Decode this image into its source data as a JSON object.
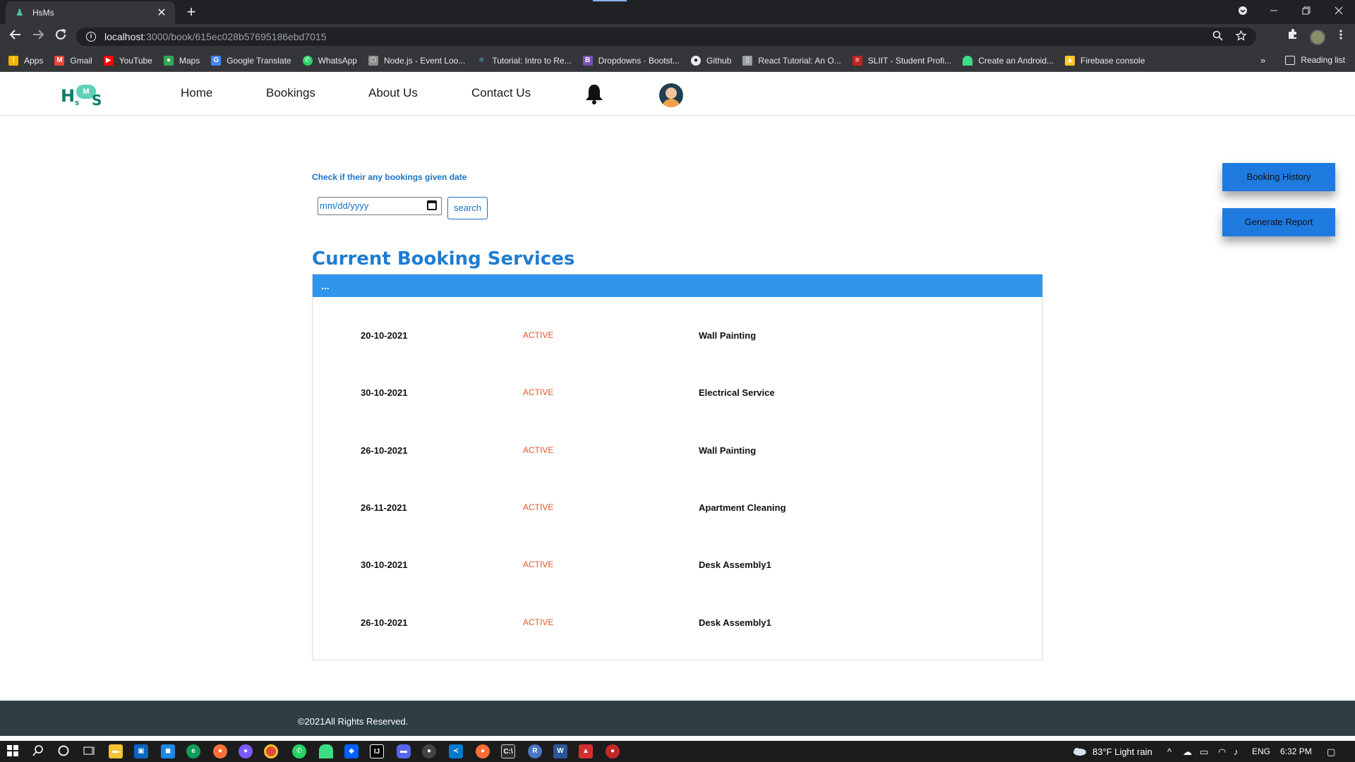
{
  "browser": {
    "tab_title": "HsMs",
    "tab_close": "✕",
    "new_tab": "+",
    "url_host": "localhost",
    "url_path": ":3000/book/615ec028b57695186ebd7015",
    "bookmarks": [
      {
        "label": "Apps",
        "icon": "apps-grid-icon",
        "color": "#f4b400"
      },
      {
        "label": "Gmail",
        "icon": "gmail-icon",
        "color": "#ea4335"
      },
      {
        "label": "YouTube",
        "icon": "youtube-icon",
        "color": "#ff0000"
      },
      {
        "label": "Maps",
        "icon": "maps-icon",
        "color": "#34a853"
      },
      {
        "label": "Google Translate",
        "icon": "translate-icon",
        "color": "#4285f4"
      },
      {
        "label": "WhatsApp",
        "icon": "whatsapp-icon",
        "color": "#25d366"
      },
      {
        "label": "Node.js - Event Loo...",
        "icon": "nodejs-icon",
        "color": "#8c8c8c"
      },
      {
        "label": "Tutorial: Intro to Re...",
        "icon": "react-icon",
        "color": "#61dafb"
      },
      {
        "label": "Dropdowns · Bootst...",
        "icon": "bootstrap-icon",
        "color": "#7952b3"
      },
      {
        "label": "Github",
        "icon": "github-icon",
        "color": "#e8eaed"
      },
      {
        "label": "React Tutorial: An O...",
        "icon": "bookmark-page-icon",
        "color": "#9aa0a6"
      },
      {
        "label": "SLIIT - Student Profi...",
        "icon": "sliit-icon",
        "color": "#c5221f"
      },
      {
        "label": "Create an Android...",
        "icon": "android-icon",
        "color": "#3ddc84"
      },
      {
        "label": "Firebase console",
        "icon": "firebase-icon",
        "color": "#ffca28"
      }
    ],
    "bookmarks_more": "»",
    "reading_list": "Reading list"
  },
  "site": {
    "logo_letters": {
      "h": "H",
      "m": "M",
      "s": "S",
      "small": "s"
    },
    "nav": {
      "home": "Home",
      "bookings": "Bookings",
      "about": "About Us",
      "contact": "Contact Us"
    }
  },
  "main": {
    "check_label": "Check if their any bookings given date",
    "date_placeholder": "mm/dd/yyyy",
    "search_label": "search",
    "section_title": "Current Booking Services",
    "card_header": "...",
    "bookings": [
      {
        "date": "20-10-2021",
        "status": "ACTIVE",
        "service": "Wall Painting"
      },
      {
        "date": "30-10-2021",
        "status": "ACTIVE",
        "service": "Electrical Service"
      },
      {
        "date": "26-10-2021",
        "status": "ACTIVE",
        "service": "Wall Painting"
      },
      {
        "date": "26-11-2021",
        "status": "ACTIVE",
        "service": "Apartment Cleaning"
      },
      {
        "date": "30-10-2021",
        "status": "ACTIVE",
        "service": "Desk Assembly1"
      },
      {
        "date": "26-10-2021",
        "status": "ACTIVE",
        "service": "Desk Assembly1"
      }
    ],
    "booking_history_label": "Booking History",
    "generate_report_label": "Generate Report"
  },
  "footer": {
    "text": "©2021All Rights Reserved."
  },
  "taskbar": {
    "weather": "83°F  Light rain",
    "language": "ENG",
    "time": "6:32 PM"
  },
  "colors": {
    "accent_blue": "#1f7cd1",
    "card_header_blue": "#2f95ec",
    "status_orange": "#e5542b",
    "footer_bg": "#2e3e44"
  }
}
